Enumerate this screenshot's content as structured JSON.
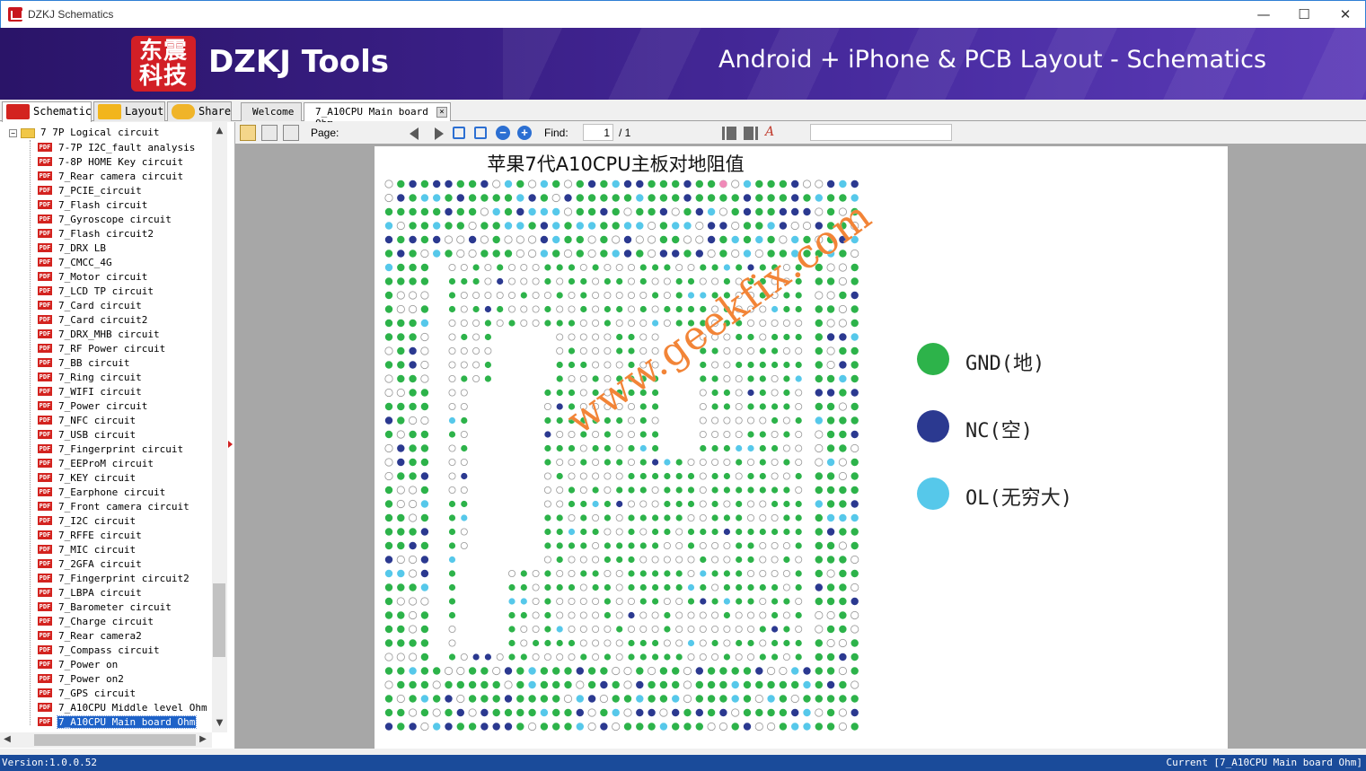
{
  "window": {
    "title": "DZKJ Schematics",
    "minimize_glyph": "—",
    "maximize_glyph": "☐",
    "close_glyph": "✕"
  },
  "banner": {
    "logo_text_line1": "东震",
    "logo_text_line2": "科技",
    "brand": "DZKJ Tools",
    "slogan": "Android + iPhone & PCB Layout - Schematics",
    "logo_color": "#d21f26"
  },
  "left_tabs": [
    {
      "label": "Schematic",
      "icon": "pdf-icon",
      "active": true
    },
    {
      "label": "Layout",
      "icon": "pads-icon",
      "active": false
    },
    {
      "label": "Share",
      "icon": "cloud-share-icon",
      "active": false
    }
  ],
  "doc_tabs": [
    {
      "label": "Welcome",
      "active": false
    },
    {
      "label": "7_A10CPU Main board Ohm",
      "active": true,
      "close": "×"
    }
  ],
  "tree": {
    "root": "7 7P Logical circuit",
    "items": [
      "7-7P I2C_fault analysis",
      "7-8P HOME Key circuit",
      "7_Rear camera circuit",
      "7_PCIE_circuit",
      "7_Flash circuit",
      "7_Gyroscope circuit",
      "7_Flash circuit2",
      "7_DRX LB",
      "7_CMCC_4G",
      "7_Motor circuit",
      "7_LCD TP circuit",
      "7_Card circuit",
      "7_Card circuit2",
      "7_DRX_MHB circuit",
      "7_RF Power circuit",
      "7_BB circuit",
      "7_Ring circuit",
      "7_WIFI circuit",
      "7_Power circuit",
      "7_NFC circuit",
      "7_USB circuit",
      "7_Fingerprint circuit",
      "7_EEProM circuit",
      "7_KEY circuit",
      "7_Earphone circuit",
      "7_Front camera circuit",
      "7_I2C circuit",
      "7_RFFE circuit",
      "7_MIC circuit",
      "7_2GFA circuit",
      "7_Fingerprint circuit2",
      "7_LBPA circuit",
      "7_Barometer circuit",
      "7_Charge circuit",
      "7_Rear camera2",
      "7_Compass circuit",
      "7_Power on",
      "7_Power on2",
      "7_GPS circuit",
      "7_A10CPU Middle level Ohm",
      "7_A10CPU Main board Ohm"
    ],
    "selected_index": 40,
    "pdf_badge": "PDF"
  },
  "toolbar": {
    "page_label": "Page:",
    "page_value": "1",
    "page_total": "/ 1",
    "find_label": "Find:",
    "find_value": "",
    "zoom_out": "−",
    "zoom_in": "+"
  },
  "document": {
    "title": "苹果7代A10CPU主板对地阻值",
    "watermark": "www.geekfix.com",
    "legend": [
      {
        "label": "GND(地)",
        "color": "#2db34a"
      },
      {
        "label": "NC(空)",
        "color": "#2b3990"
      },
      {
        "label": "OL(无穷大)",
        "color": "#56c8ea"
      }
    ],
    "pad_colors": {
      "gnd": "#2db34a",
      "nc": "#2b3990",
      "ol": "#56c8ea",
      "pink": "#f08ab8",
      "value": "#ffffff"
    }
  },
  "status": {
    "version": "Version:1.0.0.52",
    "current": "Current [7_A10CPU Main board Ohm]"
  }
}
